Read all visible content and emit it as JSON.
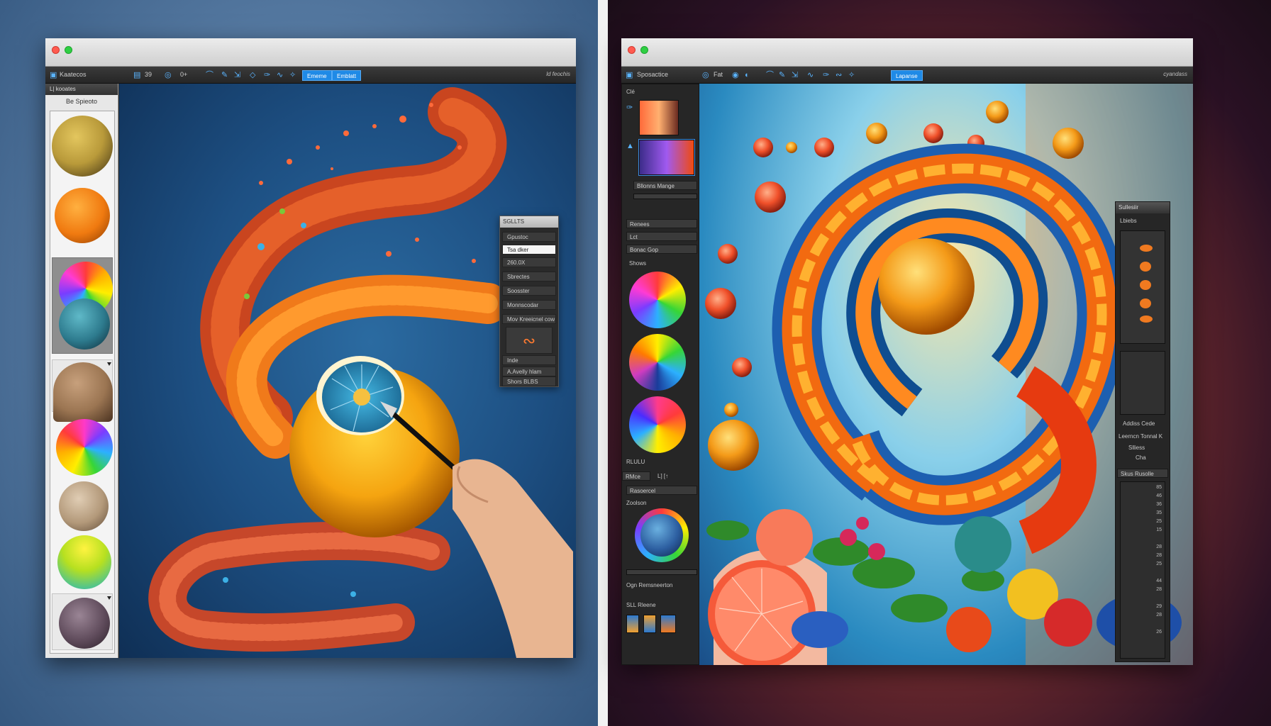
{
  "left_window": {
    "toolbar": {
      "app_label": "Kaatecos",
      "size_value": "39",
      "zoom_value": "0+",
      "tab_active": "Ememe",
      "tab_second": "Emblatt",
      "right_text": "ld feochis"
    },
    "sidebar": {
      "header": "L| kooates",
      "title": "Be Spieoto"
    },
    "float_panel": {
      "title": "SGLLTS",
      "rows": [
        "Gpustoc",
        "Tsa dker",
        "260.0X",
        "Sbrectes",
        "Soosster",
        "Monnscodar",
        "Mov Kreeicnel cow",
        "Inde",
        "A.Avelly hlam",
        "Shors  BLBS"
      ]
    }
  },
  "right_window": {
    "toolbar": {
      "app_label": "Sposactice",
      "size_value": "Fat",
      "tab_active": "Lapanse",
      "right_text": "cyandass"
    },
    "left_panel": {
      "tab_label": "Clé",
      "blend_label": "Bllonns Mange",
      "rows": [
        "Renees",
        "Lct",
        "Bonac  Gop"
      ],
      "shows_label": "Shows",
      "bottom_label": "RLULU",
      "rmce_label": "RMce",
      "rmce_values": "L] [↑",
      "resource_label": "Rasoercel",
      "position_label": "Zoolson",
      "list_label": "Ogn  Remsneerton",
      "slb_label": "SLL Rleene"
    },
    "right_panel": {
      "header": "Sullesiir",
      "label_a": "Lbiebs",
      "label_b": "Addiss Cede",
      "label_c": "Leerncn Tonnal K",
      "label_d": "Slliess",
      "label_e": "Cha",
      "label_f": "Skus Rusolle",
      "numbers": [
        "85",
        "46",
        "36",
        "35",
        "25",
        "15",
        "28",
        "28",
        "25",
        "44",
        "28",
        "29",
        "28",
        "26"
      ]
    }
  },
  "colors": {
    "accent_blue": "#1f8ae6",
    "toolbar_dark": "#2b2b2b",
    "mac_red": "#ff5b50",
    "mac_green": "#2fcf43"
  }
}
